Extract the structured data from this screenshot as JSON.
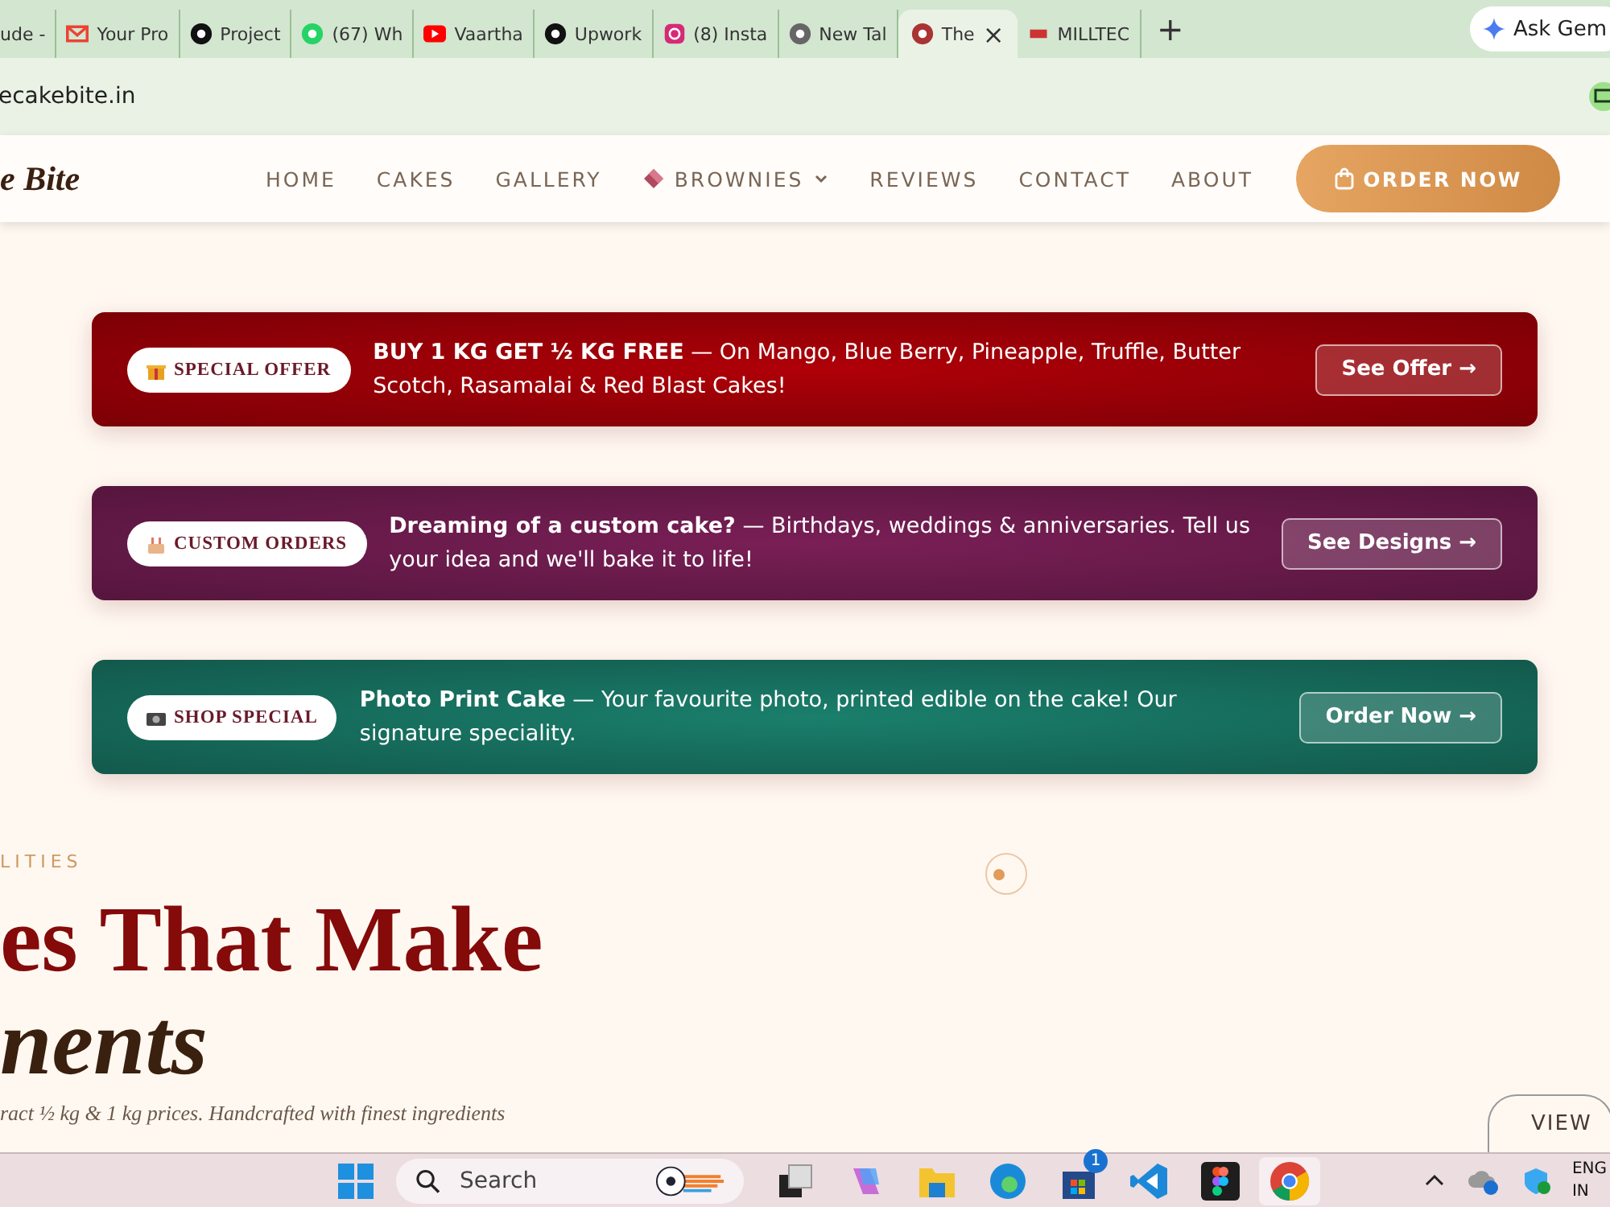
{
  "browser": {
    "tabs": [
      {
        "title": "ude -",
        "selected": false
      },
      {
        "title": "Your Pro",
        "selected": false
      },
      {
        "title": "Project",
        "selected": false
      },
      {
        "title": "(67) Wh",
        "selected": false
      },
      {
        "title": "Vaartha",
        "selected": false
      },
      {
        "title": "Upwork",
        "selected": false
      },
      {
        "title": "(8) Insta",
        "selected": false
      },
      {
        "title": "New Tal",
        "selected": false
      },
      {
        "title": "The",
        "selected": true
      },
      {
        "title": "MILLTEC",
        "selected": false
      }
    ],
    "new_tab": "+",
    "close": "×",
    "ask_button": "Ask Gem",
    "address": "ecakebite.in"
  },
  "header": {
    "logo": "e Bite",
    "nav": [
      {
        "label": "HOME",
        "dropdown": false
      },
      {
        "label": "CAKES",
        "dropdown": false
      },
      {
        "label": "GALLERY",
        "dropdown": false
      },
      {
        "label": "BROWNIES",
        "dropdown": true
      },
      {
        "label": "REVIEWS",
        "dropdown": false
      },
      {
        "label": "CONTACT",
        "dropdown": false
      },
      {
        "label": "ABOUT",
        "dropdown": false
      }
    ],
    "order_button": "ORDER NOW"
  },
  "banners": [
    {
      "badge": "SPECIAL OFFER",
      "headline": "BUY 1 KG GET ½ KG FREE",
      "text": " — On Mango, Blue Berry, Pineapple, Truffle, Butter Scotch, Rasamalai & Red Blast Cakes!",
      "button": "See Offer →",
      "color": "#b00008"
    },
    {
      "badge": "CUSTOM ORDERS",
      "headline": "Dreaming of a custom cake?",
      "text": " — Birthdays, weddings & anniversaries. Tell us your idea and we'll bake it to life!",
      "button": "See Designs →",
      "color": "#7a1f57"
    },
    {
      "badge": "SHOP SPECIAL",
      "headline": "Photo Print Cake",
      "text": " — Your favourite photo, printed edible on the cake! Our signature speciality.",
      "button": "Order Now →",
      "color": "#1a7f6c"
    }
  ],
  "section": {
    "eyebrow": "LITIES",
    "heading_line_1": "es That Make",
    "heading_line_2": "nents",
    "paragraph": "ract ½ kg & 1 kg prices. Handcrafted with finest ingredients",
    "view_button": "VIEW"
  },
  "taskbar": {
    "search_placeholder": "Search",
    "store_badge": "1",
    "language": "ENG",
    "region": "IN"
  }
}
